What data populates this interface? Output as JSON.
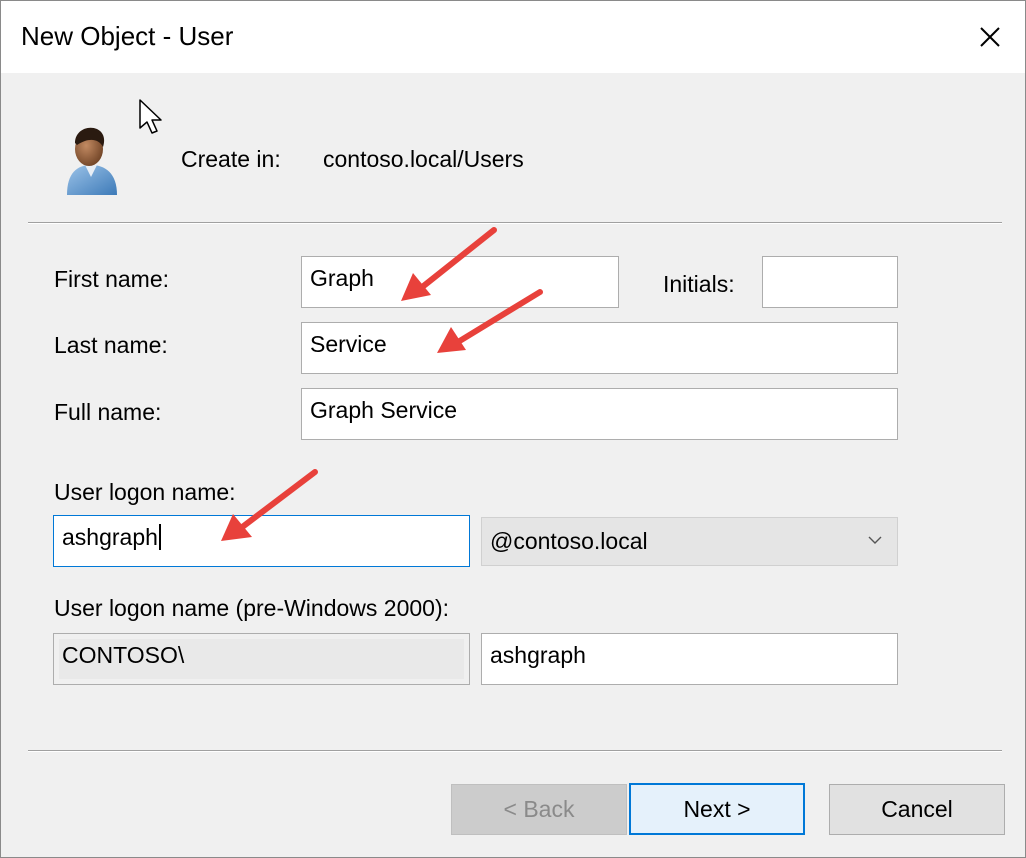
{
  "window": {
    "title": "New Object - User"
  },
  "header": {
    "create_in_label": "Create in:",
    "create_in_value": "contoso.local/Users"
  },
  "form": {
    "first_name_label": "First name:",
    "first_name_value": "Graph",
    "initials_label": "Initials:",
    "initials_value": "",
    "last_name_label": "Last name:",
    "last_name_value": "Service",
    "full_name_label": "Full name:",
    "full_name_value": "Graph Service",
    "logon_label": "User logon name:",
    "logon_value": "ashgraph",
    "domain_selected": "@contoso.local",
    "pre2000_label": "User logon name (pre-Windows 2000):",
    "pre2000_domain": "CONTOSO\\",
    "pre2000_value": "ashgraph"
  },
  "buttons": {
    "back": "< Back",
    "next": "Next >",
    "cancel": "Cancel"
  },
  "colors": {
    "annotation_arrow": "#e8413b",
    "focus_border": "#0078d7"
  }
}
